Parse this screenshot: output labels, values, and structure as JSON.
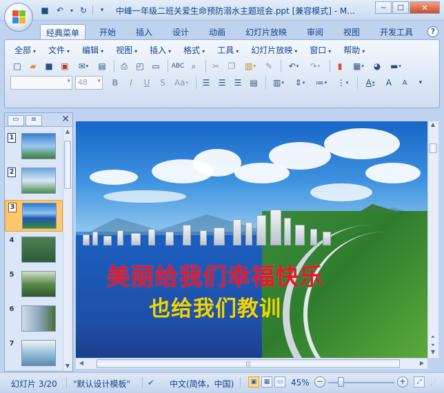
{
  "window": {
    "title": "中峰一年级二班关爱生命预防溺水主题班会.ppt [兼容模式] - M...",
    "controls": {
      "minimize": "─",
      "maximize": "☐",
      "close": "✕"
    }
  },
  "quick_access": [
    "save-icon",
    "undo-icon",
    "redo-icon",
    "customize-icon"
  ],
  "ribbon_tabs": [
    {
      "label": "经典菜单",
      "active": true
    },
    {
      "label": "开始"
    },
    {
      "label": "插入"
    },
    {
      "label": "设计"
    },
    {
      "label": "动画"
    },
    {
      "label": "幻灯片放映"
    },
    {
      "label": "审阅"
    },
    {
      "label": "视图"
    },
    {
      "label": "开发工具"
    }
  ],
  "help_label": "?",
  "classic_menu": [
    {
      "label": "全部"
    },
    {
      "label": "文件"
    },
    {
      "label": "编辑"
    },
    {
      "label": "视图"
    },
    {
      "label": "插入"
    },
    {
      "label": "格式"
    },
    {
      "label": "工具"
    },
    {
      "label": "幻灯片放映"
    },
    {
      "label": "窗口"
    },
    {
      "label": "帮助"
    }
  ],
  "font": {
    "name": "",
    "size": "48"
  },
  "format_buttons": {
    "bold": "B",
    "italic": "I",
    "underline": "U",
    "strike": "S",
    "case": "Aa"
  },
  "left_pane": {
    "tabs": [
      "slides-tab",
      "outline-tab"
    ],
    "close": "✕",
    "slides": [
      {
        "num": "1",
        "boxed": true
      },
      {
        "num": "2",
        "boxed": true
      },
      {
        "num": "3",
        "boxed": true,
        "selected": true
      },
      {
        "num": "4"
      },
      {
        "num": "5"
      },
      {
        "num": "6"
      },
      {
        "num": "7"
      }
    ]
  },
  "slide": {
    "line1": "美丽给我们幸福快乐",
    "line2": "也给我们教训",
    "colors": {
      "line1": "#e8172a",
      "line2": "#f3d400"
    }
  },
  "statusbar": {
    "slide_info": "幻灯片 3/20",
    "theme": "\"默认设计模板\"",
    "language": "中文(简体，中国)",
    "zoom": "45%",
    "zoom_out": "−",
    "zoom_in": "+"
  }
}
